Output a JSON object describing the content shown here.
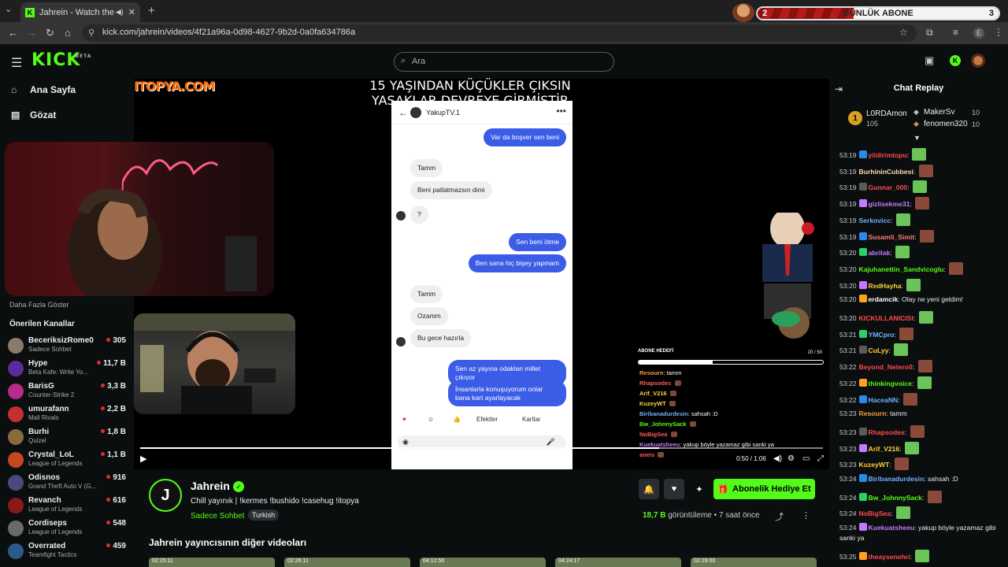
{
  "browser": {
    "tab_title": "Jahrein - Watch the VOD o",
    "url": "kick.com/jahrein/videos/4f21a96a-0d98-4627-9b2d-0a0fa634786a",
    "profile_letter": "E"
  },
  "sub_widget": {
    "label": "GÜNLÜK ABONE",
    "current": "2",
    "target": "3",
    "progress_fraction": 0.4
  },
  "header": {
    "logo": "KICK",
    "logo_beta": "BETA",
    "search_placeholder": "Ara"
  },
  "sidebar": {
    "nav": [
      {
        "label": "Ana Sayfa",
        "icon": "home-icon"
      },
      {
        "label": "Gözat",
        "icon": "browse-icon"
      }
    ],
    "show_more": "Daha Fazla Göster",
    "recommended_title": "Önerilen Kanallar",
    "channels": [
      {
        "name": "BeceriksizRome0",
        "category": "Sadece Sohbet",
        "viewers": "305",
        "color": "#8a7a6a"
      },
      {
        "name": "Hype",
        "category": "Beta Kafe: Write Yo...",
        "viewers": "11,7 B",
        "color": "#5b2a9c"
      },
      {
        "name": "BarisG",
        "category": "Counter-Strike 2",
        "viewers": "3,3 B",
        "color": "#b52c8a"
      },
      {
        "name": "umurafann",
        "category": "Mall Rivals",
        "viewers": "2,2 B",
        "color": "#c43030"
      },
      {
        "name": "Burhi",
        "category": "Quizel",
        "viewers": "1,8 B",
        "color": "#8a6a3a"
      },
      {
        "name": "Crystal_LoL",
        "category": "League of Legends",
        "viewers": "1,1 B",
        "color": "#c4471f"
      },
      {
        "name": "Odisnos",
        "category": "Grand Theft Auto V (G...",
        "viewers": "916",
        "color": "#4a4a7a"
      },
      {
        "name": "Revanch",
        "category": "League of Legends",
        "viewers": "616",
        "color": "#8a1a1a"
      },
      {
        "name": "Cordiseps",
        "category": "League of Legends",
        "viewers": "548",
        "color": "#6a6a6a"
      },
      {
        "name": "Overrated",
        "category": "Teamfight Tactics",
        "viewers": "459",
        "color": "#2a5a8a"
      }
    ]
  },
  "video": {
    "overlay_title": "15 YAŞINDAN KÜÇÜKLER ÇIKSIN YASAKLAR DEVREYE GİRMİŞTİR",
    "sponsor": "ITOPYA.COM",
    "phone": {
      "contact": "YakupTV.1",
      "messages": [
        {
          "dir": "out",
          "text": "Var da boşver sen beni"
        },
        {
          "dir": "in",
          "text": "Tamm"
        },
        {
          "dir": "in",
          "text": "Beni patlatmazsın dimi"
        },
        {
          "dir": "in",
          "text": "?"
        },
        {
          "dir": "out",
          "text": "Sen beni ötme"
        },
        {
          "dir": "out",
          "text": "Ben sana hiç bişey yapmam"
        },
        {
          "dir": "in",
          "text": "Tamm"
        },
        {
          "dir": "in",
          "text": "Ozamm"
        },
        {
          "dir": "in",
          "text": "Bu gece hazırla"
        },
        {
          "dir": "out",
          "text": "Sen az yayına odaklan millet çıkıyor"
        },
        {
          "dir": "out",
          "text": "İnsanlarla konuşuyorum onlar bana kart ayarlayacak"
        }
      ],
      "effects": "Efektler",
      "cards": "Kartlar"
    },
    "sub_goal_title": "ABONE HEDEFİ",
    "sub_goal_count": "20 / 50",
    "sub_goal_fraction": 0.4,
    "overlay_chat": [
      {
        "user": "Resourn",
        "text": "tamm",
        "color": "#ff9a3a"
      },
      {
        "user": "Rhapsodes",
        "text": "",
        "color": "#ff5a5a"
      },
      {
        "user": "Arif_V216",
        "text": "",
        "color": "#ffd23a"
      },
      {
        "user": "KuzeyWT",
        "text": "",
        "color": "#ffd23a"
      },
      {
        "user": "Biribanadurdesin",
        "text": "sahsah :D",
        "color": "#6ab4ff"
      },
      {
        "user": "Bw_JohnnySack",
        "text": "",
        "color": "#53fc18"
      },
      {
        "user": "NoBigSea",
        "text": "",
        "color": "#ff5a5a"
      },
      {
        "user": "Kuekuatsheeu",
        "text": "yakup böyle yazamaz gibi sanki ya",
        "color": "#c27aff"
      },
      {
        "user": "aneis",
        "text": "",
        "color": "#ff5a5a"
      }
    ],
    "time": "0:50 / 1:06",
    "progress_fraction": 0.76
  },
  "info": {
    "channel": "Jahrein",
    "title": "Chill yayınık  | !kermes !bushido !casehug !itopya",
    "category": "Sadece Sohbet",
    "tag": "Turkish",
    "gift_button": "Abonelik Hediye Et",
    "views": "18,7 B",
    "views_suffix": "görüntüleme",
    "ago": "7 saat önce",
    "other_videos_title": "Jahrein yayıncısının diğer videoları",
    "thumbs": [
      "02:25:11",
      "02:26:11",
      "04:12:50",
      "04:24:17",
      "02:29:00"
    ]
  },
  "chat": {
    "title": "Chat Replay",
    "leaders": [
      {
        "name": "L0RDAmon",
        "count": "105"
      },
      {
        "name": "MakerSv",
        "count": "10"
      },
      {
        "name": "fenomen320",
        "count": "10"
      }
    ],
    "messages": [
      {
        "ts": "53:19",
        "user": "yildirimtopu",
        "text": "",
        "color": "#ff4a4a",
        "emote": true
      },
      {
        "ts": "53:19",
        "user": "BurhininCubbesi",
        "text": "",
        "color": "#ffd9a8",
        "emote": true
      },
      {
        "ts": "53:19",
        "user": "Gunnar_000",
        "text": "",
        "color": "#ff4a4a",
        "emote": true
      },
      {
        "ts": "53:19",
        "user": "gizlisekme31",
        "text": "",
        "color": "#c27aff",
        "emote": true
      },
      {
        "ts": "53:19",
        "user": "Serkovicc",
        "text": "",
        "color": "#6ab4ff",
        "emote": true
      },
      {
        "ts": "53:19",
        "user": "Susamli_Simit",
        "text": "",
        "color": "#ff7a7a",
        "emote": true
      },
      {
        "ts": "53:20",
        "user": "abrilak",
        "text": "",
        "color": "#c27aff",
        "emote": true
      },
      {
        "ts": "53:20",
        "user": "Kajuhanettin_Sandvicoglu",
        "text": "",
        "color": "#53fc18",
        "emote": true
      },
      {
        "ts": "53:20",
        "user": "RedHayha",
        "text": "",
        "color": "#ffd23a",
        "emote": true
      },
      {
        "ts": "53:20",
        "user": "erdamcik",
        "text": "Olay ne yeni geldim!",
        "color": "#ffffff",
        "emote": false
      },
      {
        "ts": "53:20",
        "user": "KICKULLANICISI",
        "text": "",
        "color": "#ff4a4a",
        "emote": true
      },
      {
        "ts": "53:21",
        "user": "YMCpro",
        "text": "",
        "color": "#6ab4ff",
        "emote": true
      },
      {
        "ts": "53:21",
        "user": "CuLyy",
        "text": "",
        "color": "#ffd23a",
        "emote": true
      },
      {
        "ts": "53:22",
        "user": "Beyond_Netero0",
        "text": "",
        "color": "#ff4a4a",
        "emote": true
      },
      {
        "ts": "53:22",
        "user": "thinkingvoice",
        "text": "",
        "color": "#53fc18",
        "emote": true
      },
      {
        "ts": "53:22",
        "user": "HaceaNN",
        "text": "",
        "color": "#6ab4ff",
        "emote": true
      },
      {
        "ts": "53:23",
        "user": "Resourn",
        "text": "tamm",
        "color": "#ff9a3a",
        "emote": false
      },
      {
        "ts": "53:23",
        "user": "Rhapsodes",
        "text": "",
        "color": "#ff4a4a",
        "emote": true
      },
      {
        "ts": "53:23",
        "user": "Arif_V216",
        "text": "",
        "color": "#ffd23a",
        "emote": true
      },
      {
        "ts": "53:23",
        "user": "KuzeyWT",
        "text": "",
        "color": "#ffd23a",
        "emote": true
      },
      {
        "ts": "53:24",
        "user": "Biribanadurdesin",
        "text": "sahsah :D",
        "color": "#6ab4ff",
        "emote": false
      },
      {
        "ts": "53:24",
        "user": "Bw_JohnnySack",
        "text": "",
        "color": "#53fc18",
        "emote": true
      },
      {
        "ts": "53:24",
        "user": "NoBigSea",
        "text": "",
        "color": "#ff4a4a",
        "emote": true
      },
      {
        "ts": "53:24",
        "user": "Kuekuatsheeu",
        "text": "yakup böyle yazamaz gibi sanki ya",
        "color": "#c27aff",
        "emote": false
      },
      {
        "ts": "53:25",
        "user": "theaysenehri",
        "text": "",
        "color": "#ff4a4a",
        "emote": true
      }
    ]
  }
}
